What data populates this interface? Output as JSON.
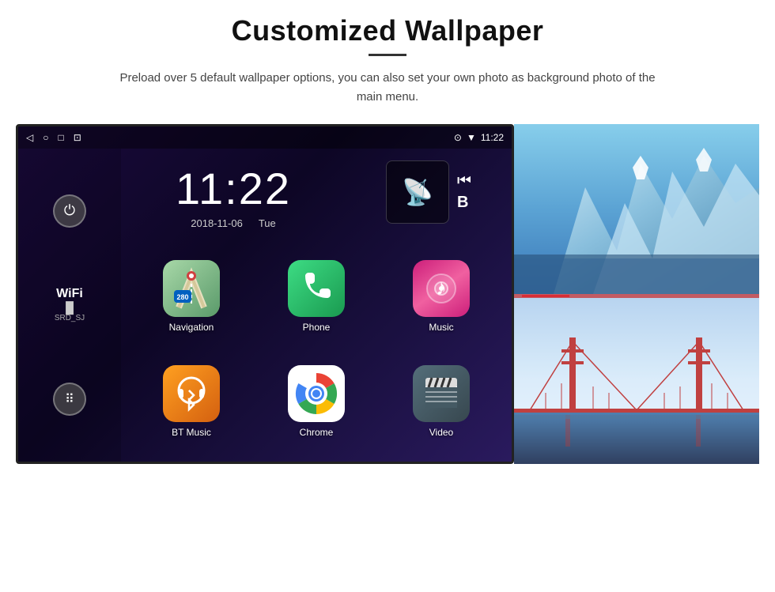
{
  "page": {
    "title": "Customized Wallpaper",
    "subtitle": "Preload over 5 default wallpaper options, you can also set your own photo as background photo of the main menu."
  },
  "device": {
    "status_bar": {
      "back_icon": "◁",
      "home_icon": "○",
      "recent_icon": "□",
      "screenshot_icon": "⊡",
      "location_icon": "⊙",
      "wifi_icon": "▼",
      "time": "11:22"
    },
    "clock": {
      "time": "11:22",
      "date": "2018-11-06",
      "day": "Tue"
    },
    "wifi": {
      "label": "WiFi",
      "ssid": "SRD_SJ"
    },
    "apps": [
      {
        "id": "navigation",
        "label": "Navigation",
        "color_from": "#4CAF50",
        "color_to": "#8BC34A"
      },
      {
        "id": "phone",
        "label": "Phone",
        "color_from": "#4CAF50",
        "color_to": "#2E7D32"
      },
      {
        "id": "music",
        "label": "Music",
        "color_from": "#E91E63",
        "color_to": "#F06292"
      },
      {
        "id": "bt_music",
        "label": "BT Music",
        "color_from": "#FF9800",
        "color_to": "#F57C00"
      },
      {
        "id": "chrome",
        "label": "Chrome",
        "color_from": "#4285F4",
        "color_to": "#EA4335"
      },
      {
        "id": "video",
        "label": "Video",
        "color_from": "#455A64",
        "color_to": "#37474F"
      }
    ],
    "side_wallpapers": [
      {
        "id": "glacier",
        "label": "Glacier wallpaper"
      },
      {
        "id": "bridge",
        "label": "Bridge wallpaper"
      }
    ]
  },
  "icons": {
    "power": "⏻",
    "apps_grid": "⊞",
    "wifi": "WiFi",
    "nav_map": "🗺",
    "phone": "📞",
    "music_note": "♪",
    "bluetooth": "Ƀ",
    "chrome": "◉",
    "video_clapperboard": "🎬",
    "media_widget": "📡",
    "prev_media": "⏮",
    "label_b": "B"
  }
}
